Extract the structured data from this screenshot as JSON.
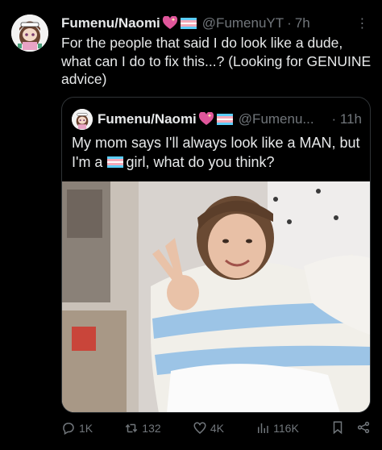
{
  "tweet": {
    "author_name": "Fumenu/Naomi",
    "author_handle": "@FumenuYT",
    "separator": "·",
    "time": "7h",
    "text": "For the people that said I do look like a dude, what can I do to fix this...? (Looking for GENUINE advice)"
  },
  "quote": {
    "author_name": "Fumenu/Naomi",
    "author_handle": "@Fumenu...",
    "separator": "·",
    "time": "11h",
    "text_before_flag": "My mom says I'll always look like a MAN, but I'm a ",
    "text_after_flag": "girl, what do you think?"
  },
  "actions": {
    "replies": "1K",
    "reposts": "132",
    "likes": "4K",
    "views": "116K"
  },
  "icons": {
    "emoji_heart": "sparkling-heart",
    "emoji_flag": "transgender-flag",
    "more": "more-icon"
  },
  "colors": {
    "background": "#000000",
    "text": "#e7e9ea",
    "muted": "#71767b",
    "border": "#2f3336",
    "heart": "#e0569b",
    "flag_blue": "#5bcefa",
    "flag_pink": "#f5a9b8"
  }
}
